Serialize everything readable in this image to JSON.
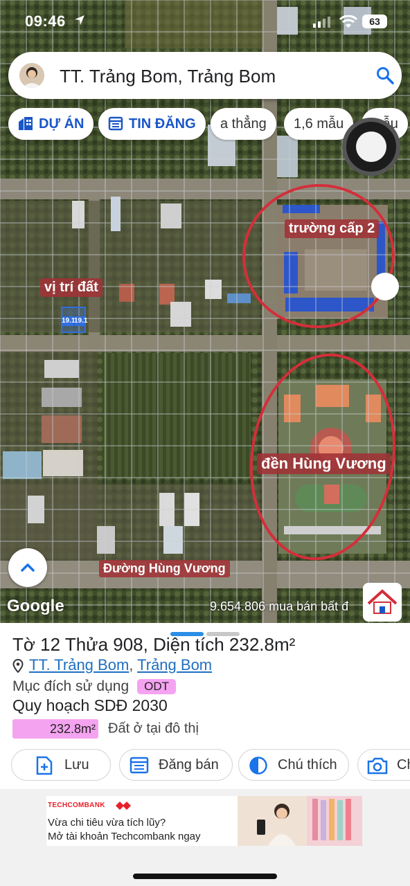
{
  "status_bar": {
    "time": "09:46",
    "battery": "63"
  },
  "search": {
    "query": "TT. Trảng Bom, Trảng Bom"
  },
  "chips": [
    {
      "label": "DỰ ÁN",
      "icon": "building-icon"
    },
    {
      "label": "TIN ĐĂNG",
      "icon": "calendar-list-icon"
    },
    {
      "label": "a thẳng"
    },
    {
      "label": "1,6 mẫu"
    },
    {
      "label": "mẫu"
    }
  ],
  "map": {
    "labels": {
      "school": "trường cấp 2",
      "land_location": "vị trí đất",
      "temple": "đền Hùng Vương",
      "road": "Đường Hùng Vương"
    },
    "parcel_tags": [
      "19.1",
      "19.1"
    ],
    "google": "Google",
    "listing_count": "9.654.806 mua bán bất đ",
    "annotation_color": "#d32f3a"
  },
  "parcel": {
    "title": "Tờ 12 Thửa 908, Diện tích 232.8m²",
    "location_link_1": "TT. Trảng Bom",
    "location_sep": ",",
    "location_link_2": "Trảng Bom",
    "purpose_label": "Mục đích sử dụng",
    "purpose_code": "ODT",
    "plan_label": "Quy hoạch SDĐ 2030",
    "area_value": "232.8m²",
    "area_desc": "Đất ở tại đô thị",
    "area_color": "#f4a3f0"
  },
  "actions": {
    "save": "Lưu",
    "post": "Đăng bán",
    "legend": "Chú thích",
    "photo": "Ch"
  },
  "ad": {
    "brand": "TECHCOMBANK",
    "line1": "Vừa chi tiêu vừa tích lũy?",
    "line2": "Mở tài khoản Techcombank ngay"
  }
}
